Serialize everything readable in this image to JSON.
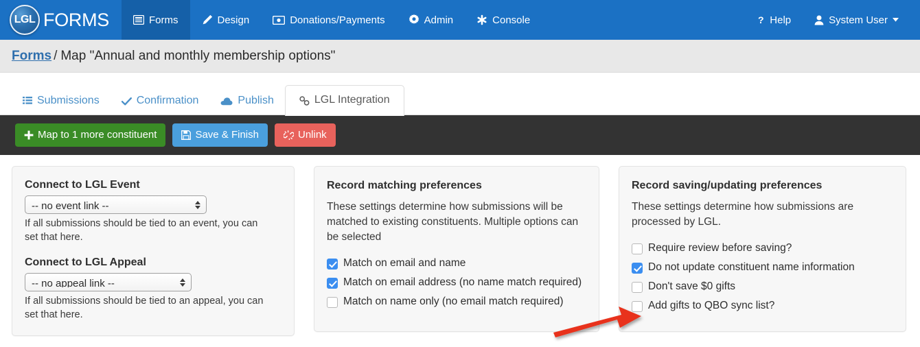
{
  "navbar": {
    "brand": {
      "badge_text": "LGL",
      "word": "FORMS",
      "icon": "lgl-circle-logo"
    },
    "items": [
      {
        "label": "Forms",
        "icon": "forms-icon",
        "active": true
      },
      {
        "label": "Design",
        "icon": "pencil-icon",
        "active": false
      },
      {
        "label": "Donations/Payments",
        "icon": "money-bill-icon",
        "active": false
      },
      {
        "label": "Admin",
        "icon": "gear-icon",
        "active": false
      },
      {
        "label": "Console",
        "icon": "asterisk-icon",
        "active": false
      }
    ],
    "right_items": [
      {
        "label": "Help",
        "icon": "question-mark-icon"
      },
      {
        "label": "System User",
        "icon": "user-icon",
        "caret": "caret-down-icon"
      }
    ],
    "background_color": "#1b71c4",
    "active_color": "#1560a8"
  },
  "breadcrumb": {
    "link_label": "Forms",
    "separator": "/",
    "current": "Map \"Annual and monthly membership options\"",
    "link_color": "#2f6fad"
  },
  "tabs": [
    {
      "label": "Submissions",
      "icon": "list-icon",
      "active": false
    },
    {
      "label": "Confirmation",
      "icon": "check-icon",
      "active": false
    },
    {
      "label": "Publish",
      "icon": "cloud-icon",
      "active": false
    },
    {
      "label": "LGL Integration",
      "icon": "link-chain-icon",
      "active": true
    }
  ],
  "toolbar": {
    "background_color": "#333333",
    "buttons": [
      {
        "label": "Map to 1 more constituent",
        "icon": "plus-icon",
        "color": "#3a8c26",
        "style": "green"
      },
      {
        "label": "Save & Finish",
        "icon": "floppy-disk-icon",
        "color": "#4a9fdd",
        "style": "blue"
      },
      {
        "label": "Unlink",
        "icon": "broken-link-icon",
        "color": "#e8625c",
        "style": "red"
      }
    ]
  },
  "panels": {
    "event_appeal": {
      "event_label": "Connect to LGL Event",
      "event_select_value": "-- no event link --",
      "event_help": "If all submissions should be tied to an event, you can set that here.",
      "appeal_label": "Connect to LGL Appeal",
      "appeal_select_value": "-- no appeal link --",
      "appeal_help": "If all submissions should be tied to an appeal, you can set that here."
    },
    "matching": {
      "title": "Record matching preferences",
      "description": "These settings determine how submissions will be matched to existing constituents. Multiple options can be selected",
      "options": [
        {
          "label": "Match on email and name",
          "checked": true
        },
        {
          "label": "Match on email address (no name match required)",
          "checked": true
        },
        {
          "label": "Match on name only (no email match required)",
          "checked": false
        }
      ]
    },
    "saving": {
      "title": "Record saving/updating preferences",
      "description": "These settings determine how submissions are processed by LGL.",
      "options": [
        {
          "label": "Require review before saving?",
          "checked": false
        },
        {
          "label": "Do not update constituent name information",
          "checked": true
        },
        {
          "label": "Don't save $0 gifts",
          "checked": false
        },
        {
          "label": "Add gifts to QBO sync list?",
          "checked": false
        }
      ]
    }
  },
  "annotation": {
    "type": "red-arrow",
    "color": "#e8301a",
    "points_to": "Add gifts to QBO sync list?"
  }
}
